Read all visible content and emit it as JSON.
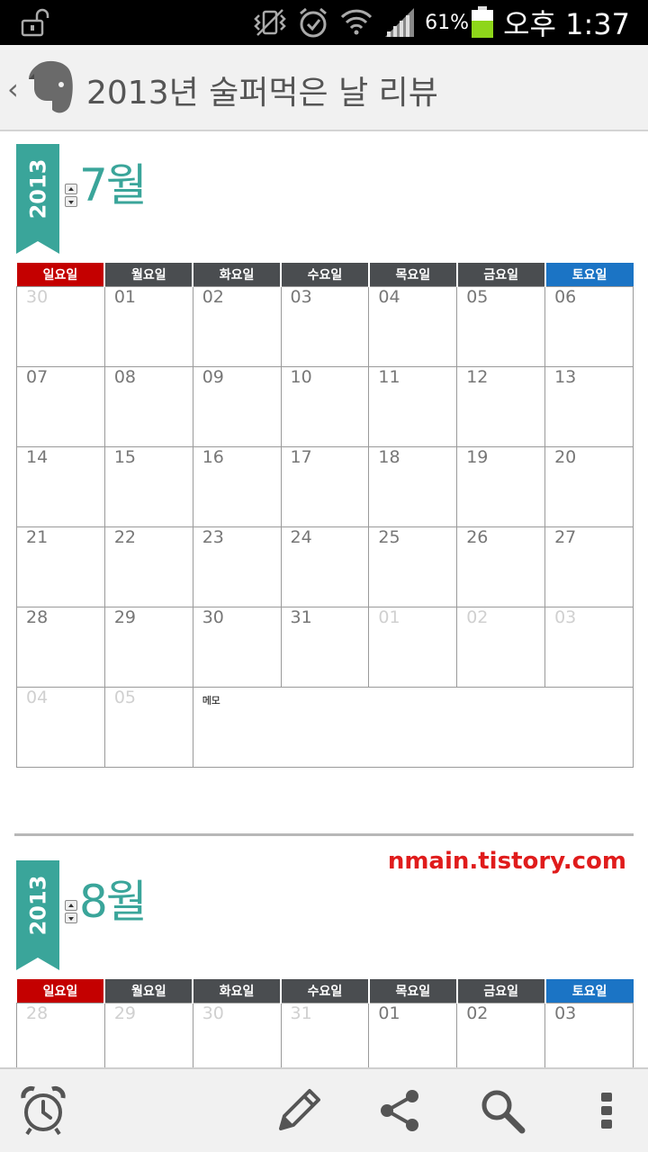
{
  "status_bar": {
    "battery": "61%",
    "time": "오후 1:37",
    "icons": [
      "unlock-icon",
      "vibrate-icon",
      "alarm-icon",
      "wifi-icon",
      "signal-icon",
      "battery-icon"
    ]
  },
  "app_bar": {
    "title": "2013년 술퍼먹은 날 리뷰",
    "back_glyph": "‹",
    "logo": "evernote-elephant-icon"
  },
  "weekdays": [
    "일요일",
    "월요일",
    "화요일",
    "수요일",
    "목요일",
    "금요일",
    "토요일"
  ],
  "months": [
    {
      "year": "2013",
      "title": "7월",
      "weeks": [
        [
          "30",
          "01",
          "02",
          "03",
          "04",
          "05",
          "06"
        ],
        [
          "07",
          "08",
          "09",
          "10",
          "11",
          "12",
          "13"
        ],
        [
          "14",
          "15",
          "16",
          "17",
          "18",
          "19",
          "20"
        ],
        [
          "21",
          "22",
          "23",
          "24",
          "25",
          "26",
          "27"
        ],
        [
          "28",
          "29",
          "30",
          "31",
          "01",
          "02",
          "03"
        ],
        [
          "04",
          "05"
        ]
      ],
      "memo_label": "메모"
    },
    {
      "year": "2013",
      "title": "8월",
      "weeks": [
        [
          "28",
          "29",
          "30",
          "31",
          "01",
          "02",
          "03"
        ]
      ]
    }
  ],
  "watermark": "nmain.tistory.com",
  "colors": {
    "accent": "#3aa59a",
    "sunday": "#c40000",
    "saturday": "#1b74c5",
    "weekday": "#4a4d50",
    "watermark": "#e01c1c"
  },
  "toolbar": {
    "icons": [
      "alarm-clock-icon",
      "pencil-icon",
      "share-icon",
      "search-icon",
      "overflow-menu-icon"
    ]
  }
}
